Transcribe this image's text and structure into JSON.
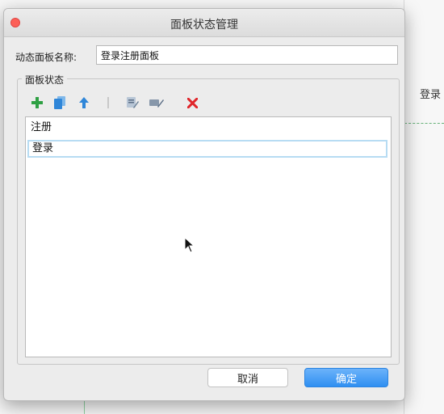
{
  "dialog": {
    "title": "面板状态管理",
    "name_label": "动态面板名称:",
    "name_value": "登录注册面板",
    "group_label": "面板状态",
    "toolbar": {
      "icons": [
        "add-icon",
        "duplicate-icon",
        "move-up-icon",
        "move-down-icon",
        "edit-icon",
        "edit-all-icon",
        "delete-icon"
      ],
      "colors": {
        "add": "#2ea043",
        "duplicate": "#2f86d8",
        "move_up": "#2f86d8",
        "disabled": "#c8c8c8",
        "edit": "#6a7f96",
        "delete": "#e0262b"
      }
    },
    "states": [
      {
        "label": "注册",
        "selected": false
      },
      {
        "label": "登录",
        "selected": true
      }
    ],
    "cancel_label": "取消",
    "ok_label": "确定"
  },
  "background": {
    "right_label": "登录"
  },
  "colors": {
    "accent": "#2f8ff1",
    "selection_border": "#b7dcf3",
    "close": "#fc5f57"
  }
}
